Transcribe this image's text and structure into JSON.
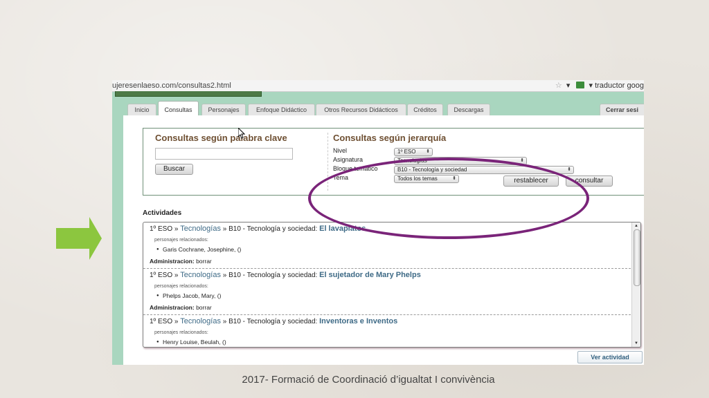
{
  "browser": {
    "url": "ujeresenlaeso.com/consultas2.html",
    "right_text": "traductor goog",
    "star_glyph": "☆",
    "dropdown_glyph": "▾"
  },
  "nav": {
    "tabs": [
      {
        "id": "inicio",
        "label": "Inicio"
      },
      {
        "id": "consultas",
        "label": "Consultas",
        "active": true
      },
      {
        "id": "personajes",
        "label": "Personajes"
      },
      {
        "id": "enfoque",
        "label": "Enfoque Didáctico"
      },
      {
        "id": "otros",
        "label": "Otros Recursos Didácticos"
      },
      {
        "id": "creditos",
        "label": "Créditos"
      },
      {
        "id": "descargas",
        "label": "Descargas"
      }
    ],
    "logout": "Cerrar sesi"
  },
  "keyword_search": {
    "title": "Consultas según palabra clave",
    "input_value": "",
    "button": "Buscar"
  },
  "hierarchy_search": {
    "title": "Consultas según jerarquía",
    "fields": [
      {
        "label": "Nivel",
        "value": "1º ESO"
      },
      {
        "label": "Asignatura",
        "value": "Tecnologías"
      },
      {
        "label": "Bloque temático",
        "value": "B10 - Tecnología y sociedad"
      },
      {
        "label": "Tema",
        "value": "Todos los temas"
      }
    ],
    "reset_button": "restablecer",
    "query_button": "consultar"
  },
  "activities": {
    "title": "Actividades",
    "separator": "»",
    "related_label": "personajes relacionados:",
    "admin_label": "Administracion:",
    "admin_action": "borrar",
    "items": [
      {
        "nivel": "1º ESO",
        "asignatura": "Tecnologías",
        "bloque": "B10 - Tecnología y sociedad:",
        "titulo": "El lavaplatos",
        "persona": "Garis Cochrane, Josephine, ()"
      },
      {
        "nivel": "1º ESO",
        "asignatura": "Tecnologías",
        "bloque": "B10 - Tecnología y sociedad:",
        "titulo": "El sujetador de Mary Phelps",
        "persona": "Phelps Jacob, Mary, ()"
      },
      {
        "nivel": "1º ESO",
        "asignatura": "Tecnologías",
        "bloque": "B10 - Tecnología y sociedad:",
        "titulo": "Inventoras e Inventos",
        "persona": "Henry Louise, Beulah, ()"
      }
    ],
    "view_button": "Ver actividad"
  },
  "caption": "2017- Formació de Coordinació d’igualtat I convivència",
  "colors": {
    "arrow": "#8cc63f",
    "highlight_oval": "#7a2479",
    "link": "#3e6a86",
    "panel_title": "#6e4f32",
    "site_background": "#a9d6bf"
  }
}
